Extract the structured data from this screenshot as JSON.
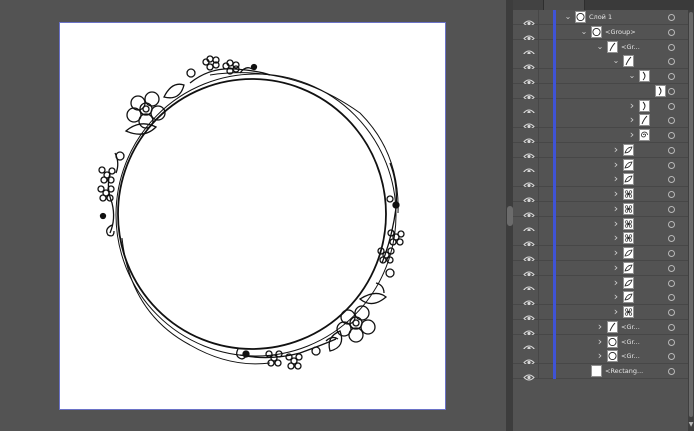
{
  "layers": {
    "rows": [
      {
        "depth": 0,
        "expanded": true,
        "label": "Слой 1",
        "thumb": "circle-thumb"
      },
      {
        "depth": 1,
        "expanded": true,
        "label": "<Group>",
        "thumb": "circle-thumb"
      },
      {
        "depth": 2,
        "expanded": true,
        "label": "<Gr...",
        "thumb": "path-thumb"
      },
      {
        "depth": 3,
        "expanded": true,
        "label": "",
        "thumb": "path-thumb"
      },
      {
        "depth": 4,
        "expanded": true,
        "label": "",
        "thumb": "bracket-thumb"
      },
      {
        "depth": 5,
        "expanded": null,
        "label": "",
        "thumb": "bracket-thumb"
      },
      {
        "depth": 4,
        "expanded": false,
        "label": "",
        "thumb": "bracket-thumb"
      },
      {
        "depth": 4,
        "expanded": false,
        "label": "",
        "thumb": "path-thumb"
      },
      {
        "depth": 4,
        "expanded": false,
        "label": "",
        "thumb": "swirl-thumb"
      },
      {
        "depth": 3,
        "expanded": false,
        "label": "",
        "thumb": "leaf-thumb"
      },
      {
        "depth": 3,
        "expanded": false,
        "label": "",
        "thumb": "leaf-thumb"
      },
      {
        "depth": 3,
        "expanded": false,
        "label": "",
        "thumb": "leaf-thumb"
      },
      {
        "depth": 3,
        "expanded": false,
        "label": "",
        "thumb": "flower-thumb"
      },
      {
        "depth": 3,
        "expanded": false,
        "label": "",
        "thumb": "flower-thumb"
      },
      {
        "depth": 3,
        "expanded": false,
        "label": "",
        "thumb": "flower-thumb"
      },
      {
        "depth": 3,
        "expanded": false,
        "label": "",
        "thumb": "flower-thumb"
      },
      {
        "depth": 3,
        "expanded": false,
        "label": "",
        "thumb": "leaf-thumb"
      },
      {
        "depth": 3,
        "expanded": false,
        "label": "",
        "thumb": "leaf-thumb"
      },
      {
        "depth": 3,
        "expanded": false,
        "label": "",
        "thumb": "leaf-thumb"
      },
      {
        "depth": 3,
        "expanded": false,
        "label": "",
        "thumb": "leaf-thumb"
      },
      {
        "depth": 3,
        "expanded": false,
        "label": "",
        "thumb": "flower-thumb"
      },
      {
        "depth": 2,
        "expanded": false,
        "label": "<Gr...",
        "thumb": "path-thumb"
      },
      {
        "depth": 2,
        "expanded": false,
        "label": "<Gr...",
        "thumb": "circle-thumb"
      },
      {
        "depth": 2,
        "expanded": false,
        "label": "<Gr...",
        "thumb": "circle-thumb"
      },
      {
        "depth": 1,
        "expanded": null,
        "label": "<Rectang...",
        "thumb": "rect-thumb"
      }
    ]
  },
  "colors": {
    "layer_color": "#3f53d6",
    "artboard_border": "#6a72c7",
    "workspace": "#535353"
  },
  "icons": {
    "visibility": "eye-icon",
    "target": "target-circle-icon",
    "expand": "chevron-right-icon",
    "collapse": "chevron-down-icon"
  }
}
